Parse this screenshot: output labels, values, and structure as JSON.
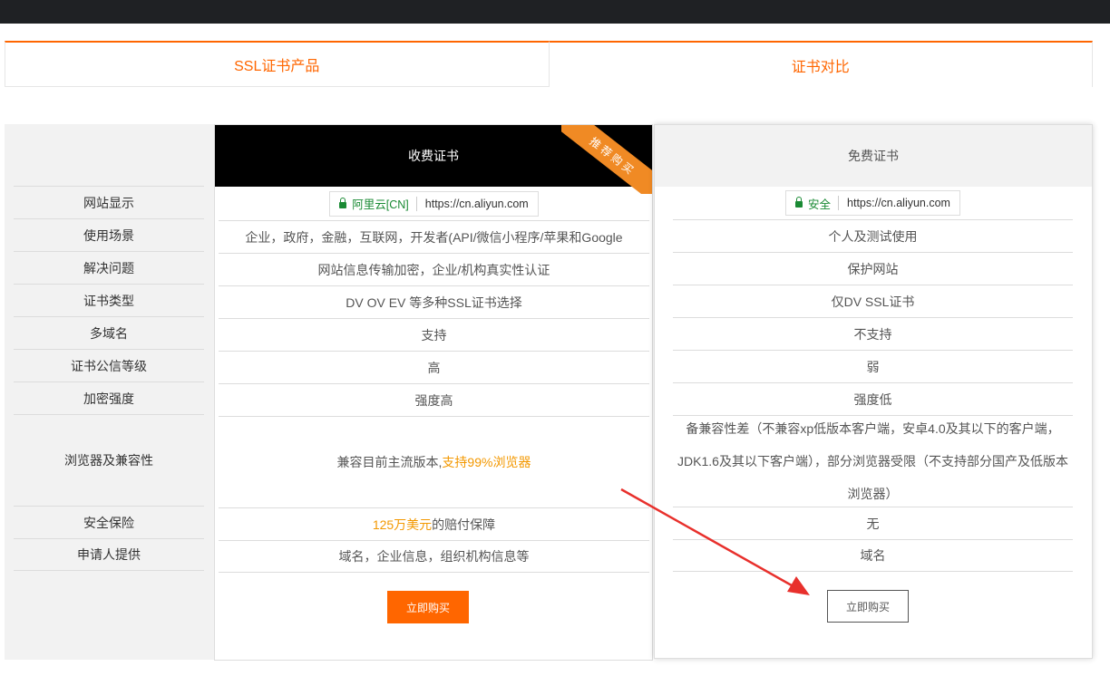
{
  "tabs": [
    {
      "label": "SSL证书产品"
    },
    {
      "label": "证书对比"
    }
  ],
  "row_labels": [
    "网站显示",
    "使用场景",
    "解决问题",
    "证书类型",
    "多域名",
    "证书公信等级",
    "加密强度",
    "浏览器及兼容性",
    "安全保险",
    "申请人提供"
  ],
  "paid": {
    "header": "收费证书",
    "ribbon": "推荐购买",
    "site_display": {
      "secure_label": "阿里云[CN]",
      "url": "https://cn.aliyun.com"
    },
    "scenario": "企业，政府，金融，互联网，开发者(API/微信小程序/苹果和Google",
    "problem": "网站信息传输加密，企业/机构真实性认证",
    "cert_type": "DV OV EV 等多种SSL证书选择",
    "multi_domain": "支持",
    "trust_level": "高",
    "encryption": "强度高",
    "compat_prefix": "兼容目前主流版本,",
    "compat_highlight": "支持99%浏览器",
    "insurance_highlight": "125万美元",
    "insurance_suffix": "的赔付保障",
    "applicant": "域名，企业信息，组织机构信息等",
    "buy_label": "立即购买"
  },
  "free": {
    "header": "免费证书",
    "site_display": {
      "secure_label": "安全",
      "url": "https://cn.aliyun.com"
    },
    "scenario": "个人及测试使用",
    "problem": "保护网站",
    "cert_type": "仅DV SSL证书",
    "multi_domain": "不支持",
    "trust_level": "弱",
    "encryption": "强度低",
    "compat": "备兼容性差（不兼容xp低版本客户端，安卓4.0及其以下的客户端，JDK1.6及其以下客户端），部分浏览器受限（不支持部分国产及低版本浏览器）",
    "insurance": "无",
    "applicant": "域名",
    "buy_label": "立即购买"
  },
  "colors": {
    "accent": "#ff6600",
    "highlight": "#f39800",
    "secure_green": "#1a8a34",
    "arrow_red": "#e8302c"
  }
}
